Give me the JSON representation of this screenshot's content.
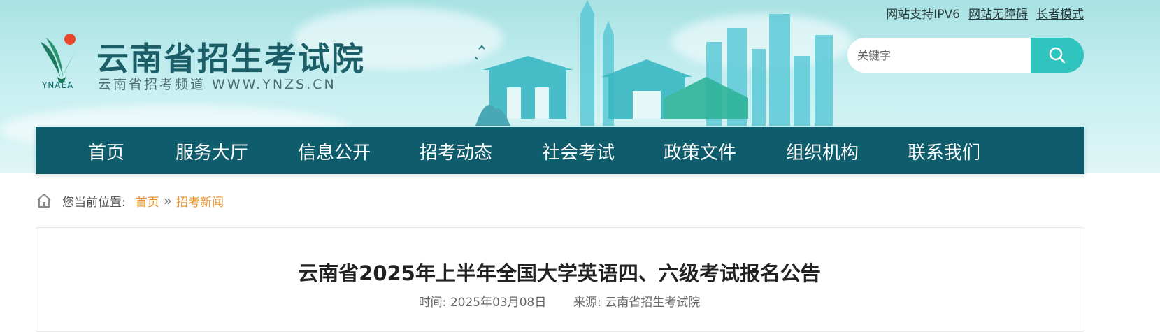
{
  "top_links": {
    "ipv6": "网站支持IPV6",
    "accessibility": "网站无障碍",
    "elderly_mode": "长者模式"
  },
  "logo": {
    "abbr": "YNAEA",
    "title": "云南省招生考试院",
    "subtitle": "云南省招考频道 WWW.YNZS.CN"
  },
  "search": {
    "placeholder": "关键字",
    "button_icon": "search-icon"
  },
  "nav": {
    "items": [
      "首页",
      "服务大厅",
      "信息公开",
      "招考动态",
      "社会考试",
      "政策文件",
      "组织机构",
      "联系我们"
    ]
  },
  "breadcrumb": {
    "label": "您当前位置:",
    "home": "首页",
    "separator": "»",
    "current": "招考新闻"
  },
  "article": {
    "title": "云南省2025年上半年全国大学英语四、六级考试报名公告",
    "time_label": "时间:",
    "time_value": "2025年03月08日",
    "source_label": "来源:",
    "source_value": "云南省招生考试院"
  },
  "colors": {
    "nav_bg": "#0f5d6c",
    "accent": "#2fc5be",
    "breadcrumb_link": "#e9912c",
    "title_color": "#1c5e68"
  }
}
